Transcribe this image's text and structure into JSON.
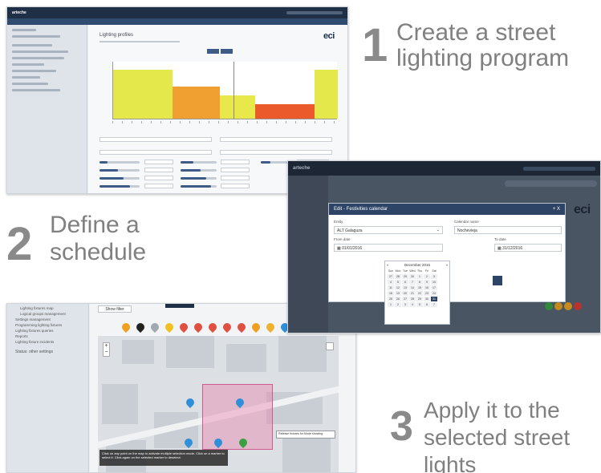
{
  "steps": [
    {
      "number": "1",
      "line1": "Create a street",
      "line2": "lighting program"
    },
    {
      "number": "2",
      "line1": "Define a",
      "line2": "schedule"
    },
    {
      "number": "3",
      "line1": "Apply it to the",
      "line2": "selected street",
      "line3": "lights"
    }
  ],
  "program_screen": {
    "brand": "arteche",
    "page_title": "Lighting profiles",
    "logo_text": "eci",
    "chart_data": {
      "type": "bar",
      "series": [
        {
          "color": "#e5e84a",
          "values": [
            0.85,
            0.85,
            0.85,
            0.85,
            0.85
          ]
        },
        {
          "color": "#f0a030",
          "values": [
            0.55,
            0.55,
            0.55,
            0.55
          ]
        },
        {
          "color": "#e8e84a",
          "values": [
            0.4,
            0.4,
            0.4
          ]
        },
        {
          "color": "#ea5a2a",
          "values": [
            0.25,
            0.25,
            0.25,
            0.25,
            0.25
          ]
        },
        {
          "color": "#e5e84a",
          "values": [
            0.85,
            0.85
          ]
        }
      ]
    }
  },
  "calendar_screen": {
    "brand": "arteche",
    "modal_title": "Edit - Festivities calendar",
    "modal_close": "+ X",
    "entity_label": "Entity",
    "entity_value": "ALT Galaguza",
    "calendar_name_label": "Calendar name",
    "calendar_name_value": "Nochevieja",
    "from_label": "From date",
    "from_value": "01/01/2016",
    "to_label": "To date",
    "to_value": "31/12/2016",
    "month_label": "December 2016",
    "weekdays": [
      "Sun",
      "Mon",
      "Tue",
      "Wed",
      "Thu",
      "Fri",
      "Sat"
    ],
    "days": [
      [
        "27",
        "28",
        "29",
        "30",
        "1",
        "2",
        "3"
      ],
      [
        "4",
        "5",
        "6",
        "7",
        "8",
        "9",
        "10"
      ],
      [
        "11",
        "12",
        "13",
        "14",
        "15",
        "16",
        "17"
      ],
      [
        "18",
        "19",
        "20",
        "21",
        "22",
        "23",
        "24"
      ],
      [
        "25",
        "26",
        "27",
        "28",
        "29",
        "30",
        "31"
      ],
      [
        "1",
        "2",
        "3",
        "4",
        "5",
        "6",
        "7"
      ]
    ],
    "selected_day": "31",
    "logo_text": "eci"
  },
  "map_screen": {
    "show_filter": "Show filter",
    "sidebar_items": [
      "Lighting fixtures map",
      "Logical groups management",
      "Settings management",
      "Programming lighting fixtures",
      "Lighting fixtures queries",
      "Reports",
      "Lighting fixture incidents",
      "Status: other settings"
    ],
    "tooltip_text": "Click on any point on the map to activate multiple selection mode. Click on a marker to select it. Click again on the selected marker to deselect.",
    "select_label": "Release fixtures for Mode showing",
    "zoom_in": "+",
    "zoom_out": "−"
  },
  "colors": {
    "navy": "#1f2f45",
    "accent": "#2d4466",
    "text_gray": "#808080"
  }
}
